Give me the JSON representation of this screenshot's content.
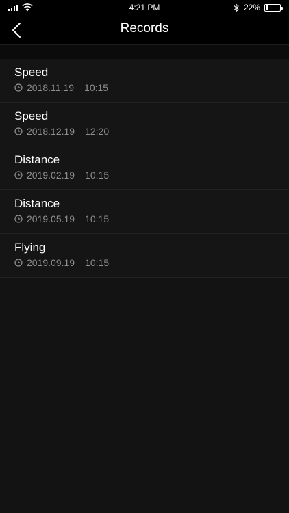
{
  "status_bar": {
    "time": "4:21 PM",
    "battery_text": "22%",
    "battery_level": 0.22
  },
  "nav": {
    "title": "Records",
    "back_icon": "chevron-left-icon"
  },
  "records": [
    {
      "title": "Speed",
      "date": "2018.11.19",
      "time": "10:15"
    },
    {
      "title": "Speed",
      "date": "2018.12.19",
      "time": "12:20"
    },
    {
      "title": "Distance",
      "date": "2019.02.19",
      "time": "10:15"
    },
    {
      "title": "Distance",
      "date": "2019.05.19",
      "time": "10:15"
    },
    {
      "title": "Flying",
      "date": "2019.09.19",
      "time": "10:15"
    }
  ],
  "colors": {
    "background": "#131313",
    "bar_background": "#000000",
    "secondary_text": "#8e8e8e"
  }
}
